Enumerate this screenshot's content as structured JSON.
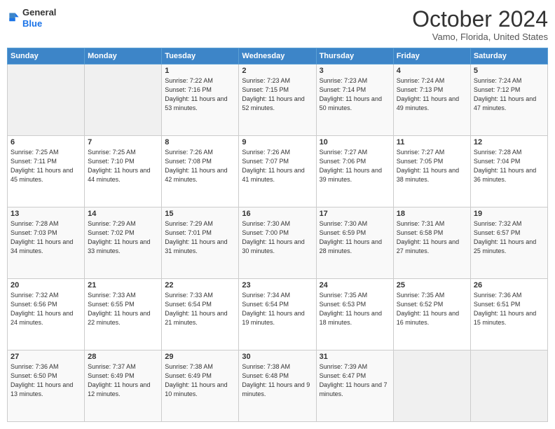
{
  "header": {
    "logo_line1": "General",
    "logo_line2": "Blue",
    "month": "October 2024",
    "location": "Vamo, Florida, United States"
  },
  "weekdays": [
    "Sunday",
    "Monday",
    "Tuesday",
    "Wednesday",
    "Thursday",
    "Friday",
    "Saturday"
  ],
  "weeks": [
    [
      {
        "day": "",
        "info": ""
      },
      {
        "day": "",
        "info": ""
      },
      {
        "day": "1",
        "info": "Sunrise: 7:22 AM\nSunset: 7:16 PM\nDaylight: 11 hours\nand 53 minutes."
      },
      {
        "day": "2",
        "info": "Sunrise: 7:23 AM\nSunset: 7:15 PM\nDaylight: 11 hours\nand 52 minutes."
      },
      {
        "day": "3",
        "info": "Sunrise: 7:23 AM\nSunset: 7:14 PM\nDaylight: 11 hours\nand 50 minutes."
      },
      {
        "day": "4",
        "info": "Sunrise: 7:24 AM\nSunset: 7:13 PM\nDaylight: 11 hours\nand 49 minutes."
      },
      {
        "day": "5",
        "info": "Sunrise: 7:24 AM\nSunset: 7:12 PM\nDaylight: 11 hours\nand 47 minutes."
      }
    ],
    [
      {
        "day": "6",
        "info": "Sunrise: 7:25 AM\nSunset: 7:11 PM\nDaylight: 11 hours\nand 45 minutes."
      },
      {
        "day": "7",
        "info": "Sunrise: 7:25 AM\nSunset: 7:10 PM\nDaylight: 11 hours\nand 44 minutes."
      },
      {
        "day": "8",
        "info": "Sunrise: 7:26 AM\nSunset: 7:08 PM\nDaylight: 11 hours\nand 42 minutes."
      },
      {
        "day": "9",
        "info": "Sunrise: 7:26 AM\nSunset: 7:07 PM\nDaylight: 11 hours\nand 41 minutes."
      },
      {
        "day": "10",
        "info": "Sunrise: 7:27 AM\nSunset: 7:06 PM\nDaylight: 11 hours\nand 39 minutes."
      },
      {
        "day": "11",
        "info": "Sunrise: 7:27 AM\nSunset: 7:05 PM\nDaylight: 11 hours\nand 38 minutes."
      },
      {
        "day": "12",
        "info": "Sunrise: 7:28 AM\nSunset: 7:04 PM\nDaylight: 11 hours\nand 36 minutes."
      }
    ],
    [
      {
        "day": "13",
        "info": "Sunrise: 7:28 AM\nSunset: 7:03 PM\nDaylight: 11 hours\nand 34 minutes."
      },
      {
        "day": "14",
        "info": "Sunrise: 7:29 AM\nSunset: 7:02 PM\nDaylight: 11 hours\nand 33 minutes."
      },
      {
        "day": "15",
        "info": "Sunrise: 7:29 AM\nSunset: 7:01 PM\nDaylight: 11 hours\nand 31 minutes."
      },
      {
        "day": "16",
        "info": "Sunrise: 7:30 AM\nSunset: 7:00 PM\nDaylight: 11 hours\nand 30 minutes."
      },
      {
        "day": "17",
        "info": "Sunrise: 7:30 AM\nSunset: 6:59 PM\nDaylight: 11 hours\nand 28 minutes."
      },
      {
        "day": "18",
        "info": "Sunrise: 7:31 AM\nSunset: 6:58 PM\nDaylight: 11 hours\nand 27 minutes."
      },
      {
        "day": "19",
        "info": "Sunrise: 7:32 AM\nSunset: 6:57 PM\nDaylight: 11 hours\nand 25 minutes."
      }
    ],
    [
      {
        "day": "20",
        "info": "Sunrise: 7:32 AM\nSunset: 6:56 PM\nDaylight: 11 hours\nand 24 minutes."
      },
      {
        "day": "21",
        "info": "Sunrise: 7:33 AM\nSunset: 6:55 PM\nDaylight: 11 hours\nand 22 minutes."
      },
      {
        "day": "22",
        "info": "Sunrise: 7:33 AM\nSunset: 6:54 PM\nDaylight: 11 hours\nand 21 minutes."
      },
      {
        "day": "23",
        "info": "Sunrise: 7:34 AM\nSunset: 6:54 PM\nDaylight: 11 hours\nand 19 minutes."
      },
      {
        "day": "24",
        "info": "Sunrise: 7:35 AM\nSunset: 6:53 PM\nDaylight: 11 hours\nand 18 minutes."
      },
      {
        "day": "25",
        "info": "Sunrise: 7:35 AM\nSunset: 6:52 PM\nDaylight: 11 hours\nand 16 minutes."
      },
      {
        "day": "26",
        "info": "Sunrise: 7:36 AM\nSunset: 6:51 PM\nDaylight: 11 hours\nand 15 minutes."
      }
    ],
    [
      {
        "day": "27",
        "info": "Sunrise: 7:36 AM\nSunset: 6:50 PM\nDaylight: 11 hours\nand 13 minutes."
      },
      {
        "day": "28",
        "info": "Sunrise: 7:37 AM\nSunset: 6:49 PM\nDaylight: 11 hours\nand 12 minutes."
      },
      {
        "day": "29",
        "info": "Sunrise: 7:38 AM\nSunset: 6:49 PM\nDaylight: 11 hours\nand 10 minutes."
      },
      {
        "day": "30",
        "info": "Sunrise: 7:38 AM\nSunset: 6:48 PM\nDaylight: 11 hours\nand 9 minutes."
      },
      {
        "day": "31",
        "info": "Sunrise: 7:39 AM\nSunset: 6:47 PM\nDaylight: 11 hours\nand 7 minutes."
      },
      {
        "day": "",
        "info": ""
      },
      {
        "day": "",
        "info": ""
      }
    ]
  ]
}
